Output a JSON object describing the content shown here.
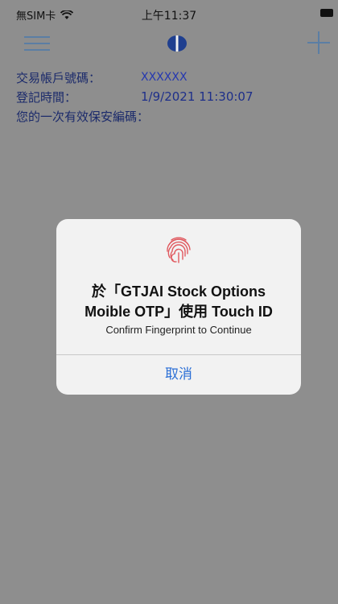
{
  "status_bar": {
    "carrier": "無SIM卡",
    "time": "上午11:37"
  },
  "account": {
    "label": "交易帳戶號碼：",
    "value": "XXXXXX"
  },
  "registration": {
    "label": "登記時間：",
    "value": "1/9/2021 11:30:07"
  },
  "security_code": {
    "label": "您的一次有效保安編碼："
  },
  "touch_id_dialog": {
    "title_line1": "於「GTJAI Stock Options",
    "title_line2": "Moible OTP」使用 Touch ID",
    "subtitle": "Confirm Fingerprint to Continue",
    "cancel_label": "取消"
  },
  "colors": {
    "background": "#8e8e8e",
    "accent": "#5b7ea4",
    "dialog_button": "#2b6fd6",
    "fingerprint": "#e0595f"
  }
}
